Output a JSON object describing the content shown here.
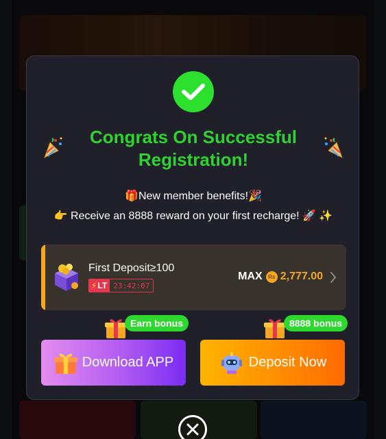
{
  "dialog": {
    "title": "Congrats On Successful Registration!",
    "benefit_line_1": "New member benefits!",
    "benefit_line_2": "Receive an 8888 reward on your first recharge!",
    "deposit_offer": {
      "title": "First Deposit≥100",
      "badge_label": "LT",
      "countdown": "23:42:07",
      "max_label": "MAX",
      "currency_symbol": "Rs",
      "max_value": "2,777.00"
    },
    "download_bonus_label": "Earn bonus",
    "deposit_bonus_label": "8888 bonus",
    "download_button_label": "Download APP",
    "deposit_button_label": "Deposit Now"
  },
  "colors": {
    "success_green": "#2ee02e",
    "accent_orange": "#f5a623",
    "timer_red": "#e8374c",
    "modal_bg": "#1f2029"
  },
  "icons": {
    "success": "checkmark-icon",
    "celebration": "party-popper-icon",
    "gift": "gift-icon",
    "pointing": "pointing-hand-icon",
    "rocket": "rocket-icon",
    "sparkles": "sparkles-icon",
    "treasure": "treasure-box-icon",
    "robot": "robot-icon",
    "close": "close-icon",
    "chevron": "chevron-right-icon"
  }
}
